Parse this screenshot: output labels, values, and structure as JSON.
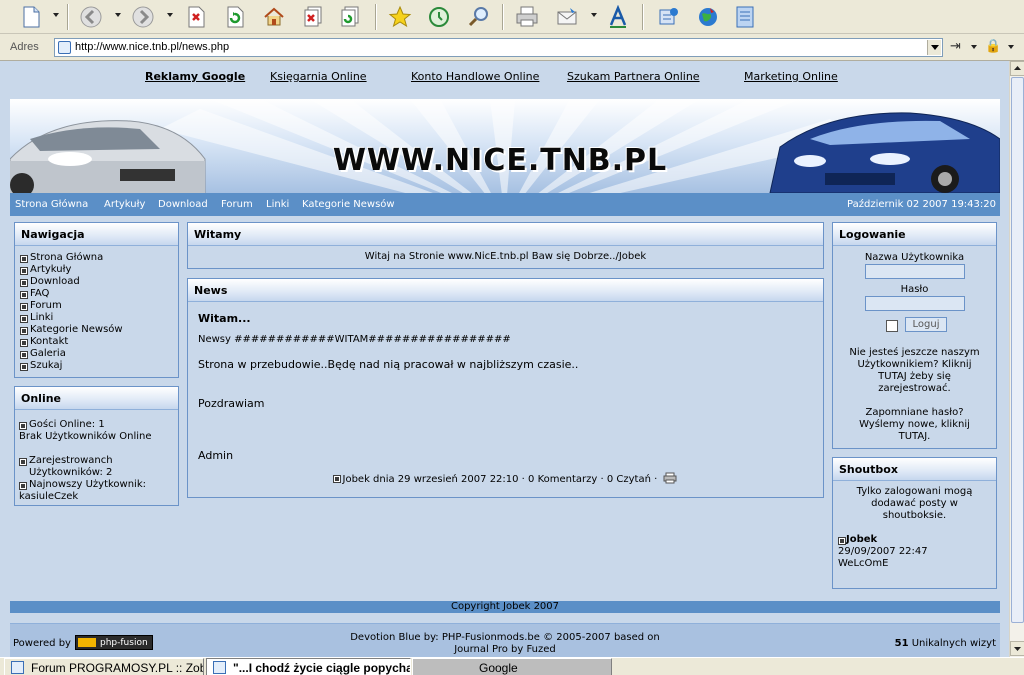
{
  "browser": {
    "address_label": "Adres",
    "url": "http://www.nice.tnb.pl/news.php",
    "toolbar_icons": [
      "new-page-icon",
      "back-icon",
      "forward-icon",
      "stop-icon",
      "refresh-icon",
      "home-icon",
      "close-tab-icon",
      "refresh-all-icon",
      "favorites-icon",
      "history-icon",
      "search-icon",
      "print-icon",
      "mail-icon",
      "fonts-icon",
      "tools-icon",
      "globe-icon",
      "notes-icon"
    ]
  },
  "page": {
    "top_links": [
      "Reklamy Google",
      "Księgarnia Online",
      "Konto Handlowe Online",
      "Szukam Partnera Online",
      "Marketing Online"
    ],
    "banner_title": "WWW.NICE.TNB.PL",
    "nav": [
      "Strona Główna",
      "Artykuły",
      "Download",
      "Forum",
      "Linki",
      "Kategorie Newsów"
    ],
    "date": "Październik 02 2007 19:43:20",
    "navigation": {
      "title": "Nawigacja",
      "items": [
        "Strona Główna",
        "Artykuły",
        "Download",
        "FAQ",
        "Forum",
        "Linki",
        "Kategorie Newsów",
        "Kontakt",
        "Galeria",
        "Szukaj"
      ]
    },
    "online": {
      "title": "Online",
      "guests": "Gości Online: 1",
      "no_users": "Brak Użytkowników Online",
      "registered": "Zarejestrowanch Użytkowników: 2",
      "newest_label": "Najnowszy Użytkownik:",
      "newest_user": "kasiuleCzek"
    },
    "welcome": {
      "title": "Witamy",
      "text": "Witaj na Stronie www.NicE.tnb.pl Baw się Dobrze../Jobek"
    },
    "news": {
      "title": "News",
      "item_title": "Witam...",
      "line1": "Newsy ############WITAM#################",
      "line2": "Strona w przebudowie..Będę nad nią pracował w najbliższym czasie..",
      "line3": "Pozdrawiam",
      "line4": "Admin",
      "meta": "Jobek dnia 29 wrzesień 2007 22:10 · 0 Komentarzy · 0 Czytań ·"
    },
    "login": {
      "title": "Logowanie",
      "username_label": "Nazwa Użytkownika",
      "password_label": "Hasło",
      "button": "Loguj",
      "register_text": "Nie jesteś jeszcze naszym Użytkownikiem? Kliknij TUTAJ żeby się zarejestrować.",
      "forgot_text": "Zapomniane hasło? Wyślemy nowe, kliknij TUTAJ."
    },
    "shoutbox": {
      "title": "Shoutbox",
      "info": "Tylko zalogowani mogą dodawać posty w shoutboksie.",
      "author": "Jobek",
      "date": "29/09/2007 22:47",
      "message": "WeLcOmE"
    },
    "footer": {
      "copyright": "Copyright Jobek 2007",
      "powered_by": "Powered by",
      "powered_logo": "php-fusion",
      "theme_line1": "Devotion Blue by: PHP-Fusionmods.be © 2005-2007 based on",
      "theme_line2": "Journal Pro by Fuzed",
      "visits_count": "51",
      "visits_label": "Unikalnych wizyt"
    }
  },
  "taskbar": {
    "items": [
      "Forum PROGRAMOSY.PL :: Zobacz",
      "\"...I chodź życie ciągle popycha",
      "Google"
    ]
  },
  "colors": {
    "page_bg": "#c9d8ea",
    "bar_blue": "#5b8fc7",
    "panel_border": "#6b93c8"
  }
}
